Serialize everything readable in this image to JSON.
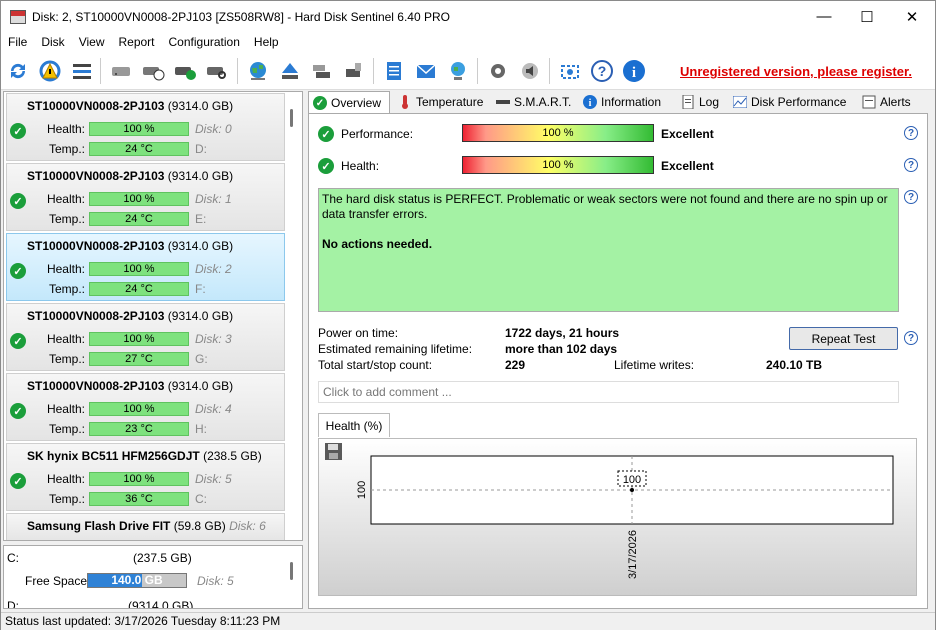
{
  "window": {
    "title": "Disk: 2, ST10000VN0008-2PJ103 [ZS508RW8]  -  Hard Disk Sentinel 6.40 PRO",
    "minimize": "—",
    "maximize": "☐",
    "close": "✕"
  },
  "menu": [
    "File",
    "Disk",
    "View",
    "Report",
    "Configuration",
    "Help"
  ],
  "register_text": "Unregistered version, please register.",
  "disks": [
    {
      "name": "ST10000VN0008-2PJ103",
      "size": "(9314.0 GB)",
      "health_label": "Health:",
      "health": "100 %",
      "disk_label": "Disk: 0",
      "temp_label": "Temp.:",
      "temp": "24 °C",
      "drive": "D:"
    },
    {
      "name": "ST10000VN0008-2PJ103",
      "size": "(9314.0 GB)",
      "health_label": "Health:",
      "health": "100 %",
      "disk_label": "Disk: 1",
      "temp_label": "Temp.:",
      "temp": "24 °C",
      "drive": "E:"
    },
    {
      "name": "ST10000VN0008-2PJ103",
      "size": "(9314.0 GB)",
      "health_label": "Health:",
      "health": "100 %",
      "disk_label": "Disk: 2",
      "temp_label": "Temp.:",
      "temp": "24 °C",
      "drive": "F:"
    },
    {
      "name": "ST10000VN0008-2PJ103",
      "size": "(9314.0 GB)",
      "health_label": "Health:",
      "health": "100 %",
      "disk_label": "Disk: 3",
      "temp_label": "Temp.:",
      "temp": "27 °C",
      "drive": "G:"
    },
    {
      "name": "ST10000VN0008-2PJ103",
      "size": "(9314.0 GB)",
      "health_label": "Health:",
      "health": "100 %",
      "disk_label": "Disk: 4",
      "temp_label": "Temp.:",
      "temp": "23 °C",
      "drive": "H:"
    },
    {
      "name": "SK hynix BC511 HFM256GDJT",
      "size": "(238.5 GB)",
      "health_label": "Health:",
      "health": "100 %",
      "disk_label": "Disk: 5",
      "temp_label": "Temp.:",
      "temp": "36 °C",
      "drive": "C:"
    }
  ],
  "disk6": {
    "name": "Samsung Flash Drive FIT",
    "size": "(59.8 GB)",
    "disk_label": "Disk: 6"
  },
  "volumes": {
    "c_label": "C:",
    "c_size": "(237.5 GB)",
    "free_label": "Free Space",
    "free_value": "140.0 GB",
    "c_disk": "Disk: 5",
    "d_label": "D:",
    "d_size": "(9314.0 GB)"
  },
  "status_bar": "Status last updated: 3/17/2026 Tuesday 8:11:23 PM",
  "tabs": [
    "Overview",
    "Temperature",
    "S.M.A.R.T.",
    "Information",
    "Log",
    "Disk Performance",
    "Alerts"
  ],
  "overview": {
    "performance_label": "Performance:",
    "performance_value": "100 %",
    "performance_rating": "Excellent",
    "health_label": "Health:",
    "health_value": "100 %",
    "health_rating": "Excellent",
    "status_text": "The hard disk status is PERFECT. Problematic or weak sectors were not found and there are no spin up or data transfer errors.",
    "action_text": "No actions needed.",
    "power_on_label": "Power on time:",
    "power_on_value": "1722 days, 21 hours",
    "lifetime_label": "Estimated remaining lifetime:",
    "lifetime_value": "more than 102 days",
    "startstop_label": "Total start/stop count:",
    "startstop_value": "229",
    "writes_label": "Lifetime writes:",
    "writes_value": "240.10 TB",
    "repeat_test": "Repeat Test",
    "comment_placeholder": "Click to add comment ...",
    "help_glyph": "?"
  },
  "chart_data": {
    "type": "line",
    "tab_label": "Health (%)",
    "x": [
      "3/17/2026"
    ],
    "series": [
      {
        "values": [
          100
        ]
      }
    ],
    "y_tick": "100",
    "x_tick": "3/17/2026",
    "point_label": "100"
  }
}
